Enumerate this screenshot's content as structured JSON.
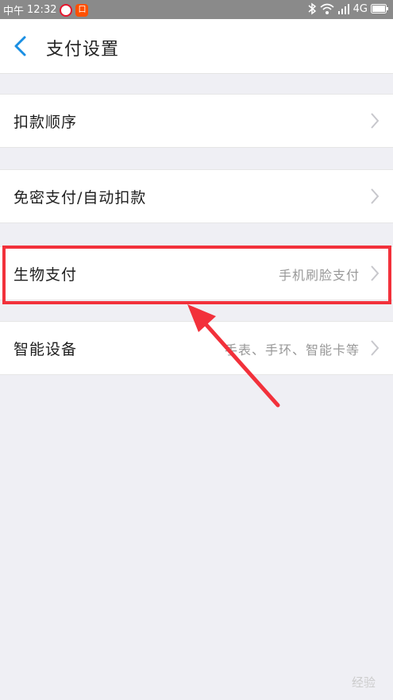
{
  "status_bar": {
    "carrier": "中午",
    "time": "12:32",
    "network": "4G",
    "apps": [
      "weibo-icon",
      "taobao-icon"
    ]
  },
  "header": {
    "back_icon": "chevron-left-icon",
    "title": "支付设置"
  },
  "settings": [
    {
      "label": "扣款顺序",
      "value": ""
    },
    {
      "label": "免密支付/自动扣款",
      "value": ""
    },
    {
      "label": "生物支付",
      "value": "手机刷脸支付"
    },
    {
      "label": "智能设备",
      "value": "手表、手环、智能卡等"
    }
  ],
  "annotation": {
    "highlight_color": "#f2313b",
    "highlighted_item": "生物支付"
  },
  "watermark": "经验"
}
